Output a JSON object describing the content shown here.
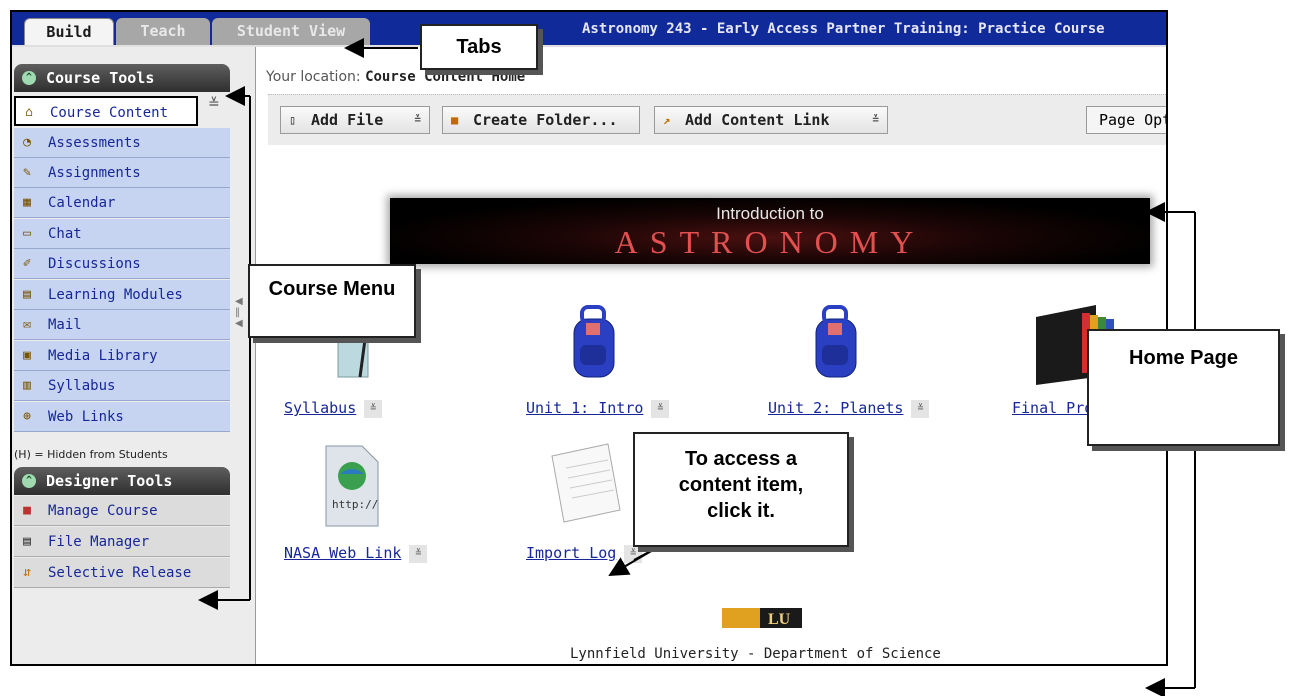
{
  "tabs": [
    {
      "label": "Build"
    },
    {
      "label": "Teach"
    },
    {
      "label": "Student View"
    }
  ],
  "course_title": "Astronomy 243 - Early Access Partner Training: Practice Course",
  "sidebar": {
    "course_tools": {
      "header": "Course Tools",
      "items": [
        {
          "label": "Course Content",
          "icon": "home-icon"
        },
        {
          "label": "Assessments",
          "icon": "assessment-icon"
        },
        {
          "label": "Assignments",
          "icon": "assignment-icon"
        },
        {
          "label": "Calendar",
          "icon": "calendar-icon"
        },
        {
          "label": "Chat",
          "icon": "chat-icon"
        },
        {
          "label": "Discussions",
          "icon": "pin-icon"
        },
        {
          "label": "Learning Modules",
          "icon": "module-icon"
        },
        {
          "label": "Mail",
          "icon": "mail-icon"
        },
        {
          "label": "Media Library",
          "icon": "media-icon"
        },
        {
          "label": "Syllabus",
          "icon": "syllabus-icon"
        },
        {
          "label": "Web Links",
          "icon": "globe-icon"
        }
      ],
      "hidden_note": "(H) = Hidden from Students"
    },
    "designer_tools": {
      "header": "Designer Tools",
      "items": [
        {
          "label": "Manage Course",
          "icon": "toolbox-icon"
        },
        {
          "label": "File Manager",
          "icon": "file-manager-icon"
        },
        {
          "label": "Selective Release",
          "icon": "release-icon"
        }
      ]
    }
  },
  "main": {
    "location_label": "Your location:",
    "location_value": "Course Content Home",
    "toolbar": {
      "add_file": "Add File",
      "create_folder": "Create Folder...",
      "add_content_link": "Add Content Link",
      "page_options": "Page Options"
    },
    "banner": {
      "line1": "Introduction to",
      "line2": "ASTRONOMY"
    },
    "items": [
      {
        "label": "Syllabus",
        "icon": "syllabus-document-icon"
      },
      {
        "label": "Unit 1: Intro",
        "icon": "backpack-icon"
      },
      {
        "label": "Unit 2: Planets",
        "icon": "backpack-icon"
      },
      {
        "label": "Final Proj",
        "icon": "file-sorter-icon"
      },
      {
        "label": "NASA Web Link",
        "icon": "weblink-globe-icon"
      },
      {
        "label": "Import Log",
        "icon": "notepad-icon"
      }
    ],
    "footer_logo": "LU",
    "footer_text": "Lynnfield University - Department of Science"
  },
  "callouts": {
    "tabs": "Tabs",
    "course_menu": "Course Menu",
    "home_page": "Home Page",
    "access": "To access a content item, click it."
  },
  "colors": {
    "topbar": "#102a9a",
    "menu_item": "#c6d4f1",
    "link": "#17279a",
    "banner_text": "#e25050"
  }
}
